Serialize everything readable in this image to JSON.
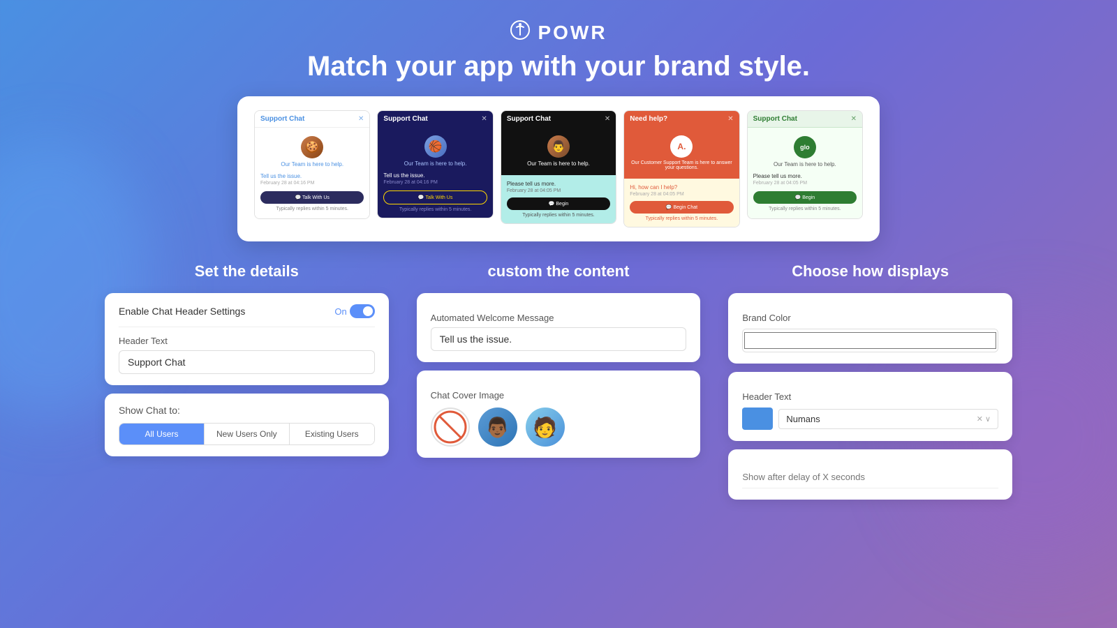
{
  "header": {
    "logo_text": "POWR",
    "headline": "Match your app with your brand style."
  },
  "preview": {
    "cards": [
      {
        "id": "card1",
        "title": "Support Chat",
        "theme": "light",
        "avatar": "🍪",
        "helper": "Our Team is here to help.",
        "message": "Tell us the issue.",
        "date": "February 28 at 04:16 PM",
        "button": "Talk With Us",
        "reply": "Typically replies within 5 minutes."
      },
      {
        "id": "card2",
        "title": "Support Chat",
        "theme": "dark-blue",
        "avatar": "🏀",
        "helper": "Our Team is here to help.",
        "message": "Tell us the issue.",
        "date": "February 28 at 04:16 PM",
        "button": "Talk With Us",
        "reply": "Typically replies within 5 minutes."
      },
      {
        "id": "card3",
        "title": "Support Chat",
        "theme": "black",
        "avatar": "👨",
        "helper": "Our Team is here to help.",
        "message": "Please tell us more.",
        "date": "February 28 at 04:05 PM",
        "button": "Begin",
        "reply": "Typically replies within 5 minutes."
      },
      {
        "id": "card4",
        "title": "Need help?",
        "theme": "red",
        "avatar": "A",
        "helper": "Our Customer Support Team is here to answer your questions.",
        "message": "Hi, how can I help?",
        "date": "February 28 at 04:05 PM",
        "button": "Begin Chat",
        "reply": "Typically replies within 5 minutes."
      },
      {
        "id": "card5",
        "title": "Support Chat",
        "theme": "mint",
        "avatar": "glo",
        "helper": "Our Team is here to help.",
        "message": "Please tell us more.",
        "date": "February 28 at 04:05 PM",
        "button": "Begin",
        "reply": "Typically replies within 5 minutes."
      }
    ]
  },
  "sections": {
    "left": {
      "title": "Set the details",
      "enable_label": "Enable Chat Header Settings",
      "toggle_state": "On",
      "header_text_label": "Header Text",
      "header_text_value": "Support Chat",
      "show_chat_label": "Show Chat to:",
      "show_chat_options": [
        "All Users",
        "New Users Only",
        "Existing Users"
      ]
    },
    "middle": {
      "title": "custom the content",
      "welcome_message_label": "Automated Welcome Message",
      "welcome_message_value": "Tell us the issue.",
      "cover_image_label": "Chat Cover Image"
    },
    "right": {
      "title": "Choose how displays",
      "brand_color_label": "Brand Color",
      "brand_color_value": "",
      "header_text_label": "Header Text",
      "header_font_value": "Numans",
      "delay_placeholder": "Show after delay of X seconds"
    }
  }
}
